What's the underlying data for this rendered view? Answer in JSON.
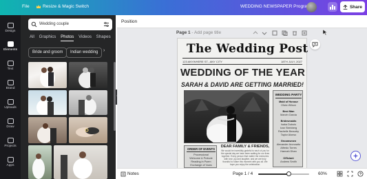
{
  "topbar": {
    "file_label": "File",
    "resize_label": "Resize & Magic Switch",
    "doc_title": "WEDDING NEWSPAPER Program",
    "share_label": "Share"
  },
  "rail": {
    "items": [
      {
        "label": "Design"
      },
      {
        "label": "Elements"
      },
      {
        "label": "Text"
      },
      {
        "label": "Brand"
      },
      {
        "label": "Uploads"
      },
      {
        "label": "Draw"
      },
      {
        "label": "Projects"
      },
      {
        "label": "Apps"
      }
    ],
    "active": "Elements"
  },
  "panel": {
    "search_value": "Wedding couple",
    "tabs": [
      "All",
      "Graphics",
      "Photos",
      "Videos",
      "Shapes"
    ],
    "active_tab": "Photos",
    "chips": [
      "Bride and groom",
      "Indian wedding"
    ]
  },
  "editor": {
    "position_label": "Position",
    "page_label": "Page 1",
    "page_title_placeholder": "- Add page title"
  },
  "newspaper": {
    "masthead": "The Wedding Post",
    "dateline_left": "123 ANYWHERE ST., ANY CITY",
    "dateline_right": "18TH JULY, 2027",
    "headline": "WEDDING OF THE YEAR",
    "subhead": "SARAH & DAVID ARE GETTING MARRIED!",
    "wedding_party": {
      "title": "WEDDING PARTY",
      "roles": [
        {
          "role": "Maid of Honour",
          "names": [
            "Olivia Wilson"
          ]
        },
        {
          "role": "Best Man",
          "names": [
            "Marvin Garcia"
          ]
        },
        {
          "role": "Bridesmaids",
          "names": [
            "Isaka Dubois",
            "Ivan Steinberg",
            "Rachelle Beaudry",
            "Taylor Alonso"
          ]
        },
        {
          "role": "Groomsmen",
          "names": [
            "Alexander Aronowitz",
            "Alfredo Torres",
            "Hannah Dhan"
          ]
        },
        {
          "role": "Officiant",
          "names": [
            "Andrew Smith"
          ]
        }
      ]
    },
    "order_of_events": {
      "title": "ORDER OF EVENTS",
      "lines": [
        "Processional",
        "Welcome & Prelude",
        "Reading in Poem",
        "Exchange of Vows"
      ]
    },
    "dear_heading": "DEAR FAMILY & FRIENDS,",
    "body_text": "We would be incredibly grateful to each of you for the special day we have been waiting for our lives together. Every person that matter the memories with love, joy and laughter, and we are truly thankful to share this moment with you all. We hope you enjoy the celebration."
  },
  "bottombar": {
    "notes_label": "Notes",
    "page_indicator": "Page 1 / 4",
    "zoom_label": "60%",
    "zoom_level": 0.6
  }
}
